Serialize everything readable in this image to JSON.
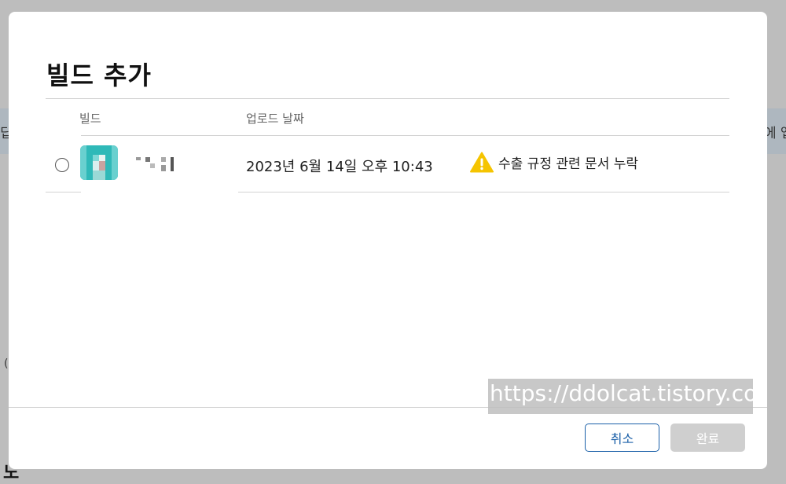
{
  "background": {
    "left_text": "딥",
    "right_text": "에 앱",
    "edge_mark": "(",
    "bottom_mark": "노"
  },
  "modal": {
    "title": "빌드 추가",
    "columns": {
      "build": "빌드",
      "upload_date": "업로드 날짜"
    },
    "rows": [
      {
        "upload_date": "2023년 6월 14일 오후 10:43",
        "warning": "수출 규정 관련 문서 누락",
        "icon": "app-icon-blurred",
        "name_blurred": true
      }
    ],
    "buttons": {
      "cancel": "취소",
      "done": "완료"
    }
  },
  "watermark": "https://ddolcat.tistory.com",
  "colors": {
    "accent": "#1a5fa8",
    "app_icon": "#2fb9b8",
    "warning": "#f5c400",
    "disabled_button": "#cfcfcf"
  }
}
